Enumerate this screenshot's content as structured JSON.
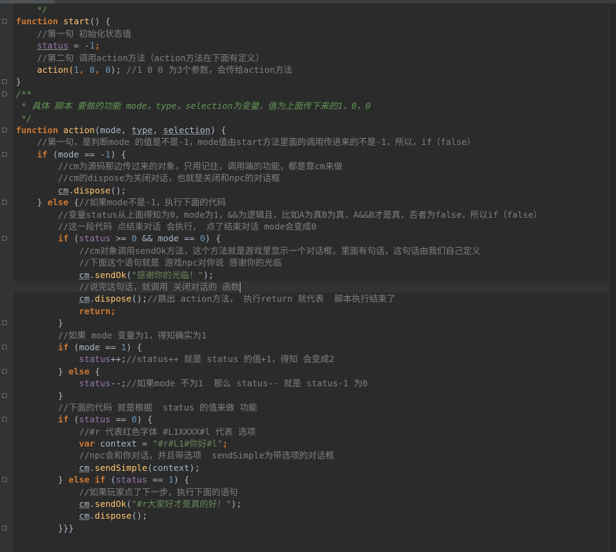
{
  "editor": {
    "language": "javascript",
    "current_line_index": 23,
    "lines": [
      {
        "indent": 1,
        "fold": false,
        "tokens": [
          {
            "t": "*/",
            "c": "doc"
          }
        ]
      },
      {
        "indent": 0,
        "fold": true,
        "tokens": [
          {
            "t": "function",
            "c": "kw"
          },
          {
            "t": " ",
            "c": "op"
          },
          {
            "t": "start",
            "c": "fn"
          },
          {
            "t": "() {",
            "c": "op"
          }
        ]
      },
      {
        "indent": 1,
        "fold": false,
        "tokens": [
          {
            "t": "//第一句 初始化状态值",
            "c": "cmt"
          }
        ]
      },
      {
        "indent": 1,
        "fold": false,
        "tokens": [
          {
            "t": "status",
            "c": "var",
            "ul": true
          },
          {
            "t": " = -",
            "c": "op"
          },
          {
            "t": "1",
            "c": "num"
          },
          {
            "t": ";",
            "c": "kw"
          }
        ]
      },
      {
        "indent": 1,
        "fold": false,
        "tokens": [
          {
            "t": "//第二句 调用action方法（action方法在下面有定义）",
            "c": "cmt"
          }
        ]
      },
      {
        "indent": 1,
        "fold": false,
        "tokens": [
          {
            "t": "action(",
            "c": "fn"
          },
          {
            "t": "1",
            "c": "num"
          },
          {
            "t": ", ",
            "c": "kw"
          },
          {
            "t": "0",
            "c": "num"
          },
          {
            "t": ", ",
            "c": "kw"
          },
          {
            "t": "0",
            "c": "num"
          },
          {
            "t": ");",
            "c": "op"
          },
          {
            "t": " //1 0 0 为3个参数，会传给action方法",
            "c": "cmt"
          }
        ]
      },
      {
        "indent": 0,
        "fold": true,
        "tokens": [
          {
            "t": "}",
            "c": "op"
          }
        ]
      },
      {
        "indent": 0,
        "fold": true,
        "tokens": [
          {
            "t": "/**",
            "c": "doc"
          }
        ]
      },
      {
        "indent": 0,
        "fold": false,
        "tokens": [
          {
            "t": " * 具体 脚本 要做的功能 mode，type，selection为变量，值为上面传下来的1，0，0",
            "c": "doc"
          }
        ]
      },
      {
        "indent": 0,
        "fold": false,
        "tokens": [
          {
            "t": " */",
            "c": "doc"
          }
        ]
      },
      {
        "indent": 0,
        "fold": true,
        "tokens": [
          {
            "t": "function",
            "c": "kw"
          },
          {
            "t": " ",
            "c": "op"
          },
          {
            "t": "action",
            "c": "fn"
          },
          {
            "t": "(mode, ",
            "c": "op"
          },
          {
            "t": "type",
            "c": "op",
            "ul": true
          },
          {
            "t": ", ",
            "c": "op"
          },
          {
            "t": "selection",
            "c": "op",
            "ul": true
          },
          {
            "t": ") {",
            "c": "op"
          }
        ]
      },
      {
        "indent": 1,
        "fold": false,
        "tokens": [
          {
            "t": "//第一句，是判断mode 的值是不是-1，mode值由start方法里面的调用传进来的不是-1，所以，if（false）",
            "c": "cmt"
          }
        ]
      },
      {
        "indent": 1,
        "fold": true,
        "tokens": [
          {
            "t": "if",
            "c": "kw"
          },
          {
            "t": " (mode == -",
            "c": "op"
          },
          {
            "t": "1",
            "c": "num"
          },
          {
            "t": ") {",
            "c": "op"
          }
        ]
      },
      {
        "indent": 2,
        "fold": false,
        "tokens": [
          {
            "t": "//cm为源码那边传过来的对象，只用记住，调用端的功能，都是靠cm来做",
            "c": "cmt"
          }
        ]
      },
      {
        "indent": 2,
        "fold": false,
        "tokens": [
          {
            "t": "//cm的dispose为关闭对话，也就是关闭和npc的对话框",
            "c": "cmt"
          }
        ]
      },
      {
        "indent": 2,
        "fold": false,
        "tokens": [
          {
            "t": "cm",
            "c": "op",
            "ul": true
          },
          {
            "t": ".",
            "c": "op"
          },
          {
            "t": "dispose",
            "c": "fn"
          },
          {
            "t": "();",
            "c": "op"
          }
        ]
      },
      {
        "indent": 1,
        "fold": true,
        "tokens": [
          {
            "t": "} ",
            "c": "op"
          },
          {
            "t": "else",
            "c": "kw"
          },
          {
            "t": " {",
            "c": "op"
          },
          {
            "t": "//如果mode不是-1，执行下面的代码",
            "c": "cmt"
          }
        ]
      },
      {
        "indent": 2,
        "fold": false,
        "tokens": [
          {
            "t": "//变量status从上面得知为0，mode为1，&&为逻辑且，比如A为真B为真，A&&B才是真，否者为false，所以if（false）",
            "c": "cmt"
          }
        ]
      },
      {
        "indent": 2,
        "fold": false,
        "tokens": [
          {
            "t": "//这一段代码 点结束对话 会执行， 点了结束对话 mode会变成0",
            "c": "cmt"
          }
        ]
      },
      {
        "indent": 2,
        "fold": true,
        "tokens": [
          {
            "t": "if",
            "c": "kw"
          },
          {
            "t": " (",
            "c": "op"
          },
          {
            "t": "status",
            "c": "var"
          },
          {
            "t": " >= ",
            "c": "op"
          },
          {
            "t": "0",
            "c": "num"
          },
          {
            "t": " && mode == ",
            "c": "op"
          },
          {
            "t": "0",
            "c": "num"
          },
          {
            "t": ") {",
            "c": "op"
          }
        ]
      },
      {
        "indent": 3,
        "fold": false,
        "tokens": [
          {
            "t": "//cm对象调用sendOk方法，这个方法就是游戏里显示一个对话框，里面有句话，这句话由我们自己定义",
            "c": "cmt"
          }
        ]
      },
      {
        "indent": 3,
        "fold": false,
        "tokens": [
          {
            "t": "//下面这个语句就是 游戏npc对你说 感谢你的光临",
            "c": "cmt"
          }
        ]
      },
      {
        "indent": 3,
        "fold": false,
        "tokens": [
          {
            "t": "cm",
            "c": "op",
            "ul": true
          },
          {
            "t": ".",
            "c": "op"
          },
          {
            "t": "sendOk",
            "c": "fn"
          },
          {
            "t": "(",
            "c": "op"
          },
          {
            "t": "\"感谢你的光临！\"",
            "c": "str"
          },
          {
            "t": ");",
            "c": "op"
          }
        ]
      },
      {
        "indent": 3,
        "fold": false,
        "caret": true,
        "tokens": [
          {
            "t": "//说完这句话，就调用 关闭对话的 函数",
            "c": "cmt"
          }
        ]
      },
      {
        "indent": 3,
        "fold": false,
        "tokens": [
          {
            "t": "cm",
            "c": "op",
            "ul": true
          },
          {
            "t": ".",
            "c": "op"
          },
          {
            "t": "dispose",
            "c": "fn"
          },
          {
            "t": "();",
            "c": "op"
          },
          {
            "t": "//跳出 action方法， 执行return 就代表  脚本执行结束了",
            "c": "cmt"
          }
        ]
      },
      {
        "indent": 3,
        "fold": false,
        "tokens": [
          {
            "t": "return",
            "c": "kw"
          },
          {
            "t": ";",
            "c": "kw"
          }
        ]
      },
      {
        "indent": 2,
        "fold": true,
        "tokens": [
          {
            "t": "}",
            "c": "op"
          }
        ]
      },
      {
        "indent": 2,
        "fold": false,
        "tokens": [
          {
            "t": "//如果 mode 变量为1，得知确实为1",
            "c": "cmt"
          }
        ]
      },
      {
        "indent": 2,
        "fold": true,
        "tokens": [
          {
            "t": "if",
            "c": "kw"
          },
          {
            "t": " (mode == ",
            "c": "op"
          },
          {
            "t": "1",
            "c": "num"
          },
          {
            "t": ") {",
            "c": "op"
          }
        ]
      },
      {
        "indent": 3,
        "fold": false,
        "tokens": [
          {
            "t": "status",
            "c": "var"
          },
          {
            "t": "++;",
            "c": "op"
          },
          {
            "t": "//status++ 就是 status 的值+1，得知 会变成2",
            "c": "cmt"
          }
        ]
      },
      {
        "indent": 2,
        "fold": true,
        "tokens": [
          {
            "t": "} ",
            "c": "op"
          },
          {
            "t": "else",
            "c": "kw"
          },
          {
            "t": " {",
            "c": "op"
          }
        ]
      },
      {
        "indent": 3,
        "fold": false,
        "tokens": [
          {
            "t": "status",
            "c": "var"
          },
          {
            "t": "--;",
            "c": "op"
          },
          {
            "t": "//如果mode 不为1  那么 status-- 就是 status-1 为0",
            "c": "cmt"
          }
        ]
      },
      {
        "indent": 2,
        "fold": true,
        "tokens": [
          {
            "t": "}",
            "c": "op"
          }
        ]
      },
      {
        "indent": 2,
        "fold": false,
        "tokens": [
          {
            "t": "//下面的代码 就是根据  status 的值来做 功能",
            "c": "cmt"
          }
        ]
      },
      {
        "indent": 2,
        "fold": true,
        "tokens": [
          {
            "t": "if",
            "c": "kw"
          },
          {
            "t": " (",
            "c": "op"
          },
          {
            "t": "status",
            "c": "var"
          },
          {
            "t": " == ",
            "c": "op"
          },
          {
            "t": "0",
            "c": "num"
          },
          {
            "t": ") {",
            "c": "op"
          }
        ]
      },
      {
        "indent": 3,
        "fold": false,
        "tokens": [
          {
            "t": "//#r 代表红色字体 #L1XXXX#l 代表 选项",
            "c": "cmt"
          }
        ]
      },
      {
        "indent": 3,
        "fold": false,
        "tokens": [
          {
            "t": "var",
            "c": "kw"
          },
          {
            "t": " context = ",
            "c": "op"
          },
          {
            "t": "\"#r#L1#你好#l\"",
            "c": "str"
          },
          {
            "t": ";",
            "c": "kw"
          }
        ]
      },
      {
        "indent": 3,
        "fold": false,
        "tokens": [
          {
            "t": "//npc会和你对话，并且带选项  sendSimple为带选项的对话框",
            "c": "cmt"
          }
        ]
      },
      {
        "indent": 3,
        "fold": false,
        "tokens": [
          {
            "t": "cm",
            "c": "op",
            "ul": true
          },
          {
            "t": ".",
            "c": "op"
          },
          {
            "t": "sendSimple",
            "c": "fn"
          },
          {
            "t": "(context);",
            "c": "op"
          }
        ]
      },
      {
        "indent": 2,
        "fold": true,
        "tokens": [
          {
            "t": "} ",
            "c": "op"
          },
          {
            "t": "else if",
            "c": "kw"
          },
          {
            "t": " (",
            "c": "op"
          },
          {
            "t": "status",
            "c": "var"
          },
          {
            "t": " == ",
            "c": "op"
          },
          {
            "t": "1",
            "c": "num"
          },
          {
            "t": ") {",
            "c": "op"
          }
        ]
      },
      {
        "indent": 3,
        "fold": false,
        "tokens": [
          {
            "t": "//如果玩家点了下一步，执行下面的语句",
            "c": "cmt"
          }
        ]
      },
      {
        "indent": 3,
        "fold": false,
        "tokens": [
          {
            "t": "cm",
            "c": "op",
            "ul": true
          },
          {
            "t": ".",
            "c": "op"
          },
          {
            "t": "sendOk",
            "c": "fn"
          },
          {
            "t": "(",
            "c": "op"
          },
          {
            "t": "\"#r大家好才是真的好！\"",
            "c": "str"
          },
          {
            "t": ");",
            "c": "op"
          }
        ]
      },
      {
        "indent": 3,
        "fold": false,
        "tokens": [
          {
            "t": "cm",
            "c": "op",
            "ul": true
          },
          {
            "t": ".",
            "c": "op"
          },
          {
            "t": "dispose",
            "c": "fn"
          },
          {
            "t": "();",
            "c": "op"
          }
        ]
      },
      {
        "indent": 2,
        "fold": true,
        "tokens": [
          {
            "t": "}}}",
            "c": "op"
          }
        ]
      }
    ]
  }
}
